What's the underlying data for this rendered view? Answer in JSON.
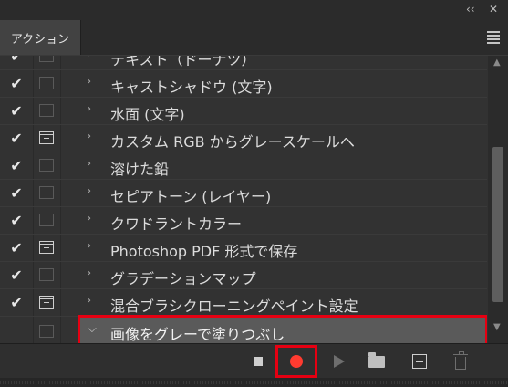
{
  "window": {
    "collapse_glyph": "‹‹",
    "close_glyph": "✕"
  },
  "tabs": [
    {
      "label": "アクション",
      "active": true
    }
  ],
  "actions": [
    {
      "label": "テキスト（ドーナツ）",
      "checked": true,
      "dialog": false,
      "partial": true
    },
    {
      "label": "キャストシャドウ (文字)",
      "checked": true,
      "dialog": false
    },
    {
      "label": "水面 (文字)",
      "checked": true,
      "dialog": false
    },
    {
      "label": "カスタム RGB からグレースケールへ",
      "checked": true,
      "dialog": true
    },
    {
      "label": "溶けた鉛",
      "checked": true,
      "dialog": false
    },
    {
      "label": "セピアトーン (レイヤー)",
      "checked": true,
      "dialog": false
    },
    {
      "label": "クワドラントカラー",
      "checked": true,
      "dialog": false
    },
    {
      "label": "Photoshop PDF 形式で保存",
      "checked": true,
      "dialog": true
    },
    {
      "label": "グラデーションマップ",
      "checked": true,
      "dialog": false
    },
    {
      "label": "混合ブラシクローニングペイント設定",
      "checked": true,
      "dialog": true
    }
  ],
  "selected_action": {
    "label": "画像をグレーで塗りつぶし",
    "expanded": true
  },
  "glyphs": {
    "check": "✔",
    "chevron_right": "›",
    "chevron_down": "⌵",
    "scroll_up": "▲",
    "scroll_down": "▼"
  },
  "toolbar": {
    "buttons": [
      "stop-icon",
      "record-icon",
      "play-icon",
      "folder-icon",
      "new-action-icon",
      "trash-icon"
    ],
    "record_color": "#ff3b30",
    "highlight_color": "#e60012"
  }
}
